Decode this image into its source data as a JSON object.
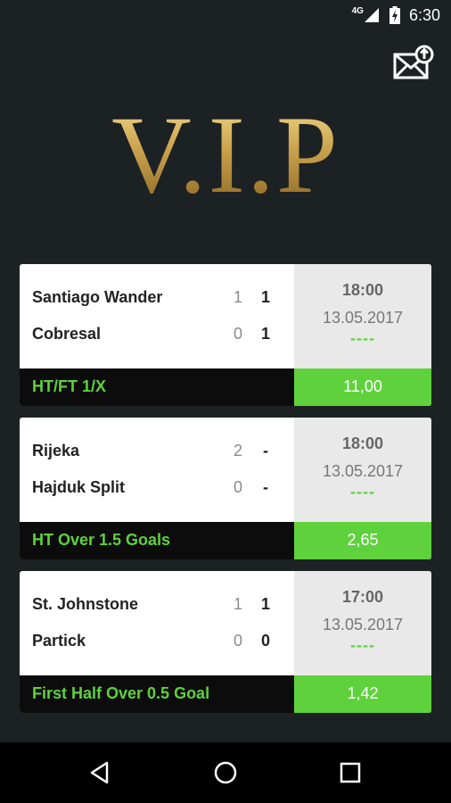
{
  "status_bar": {
    "network": "4G",
    "time": "6:30"
  },
  "header": {
    "logo_text": "V.I.P",
    "mail_icon": "mail-upload-icon"
  },
  "matches": [
    {
      "home_team": "Santiago Wander",
      "away_team": "Cobresal",
      "home_ht": "1",
      "home_ft": "1",
      "away_ht": "0",
      "away_ft": "1",
      "time": "18:00",
      "date": "13.05.2017",
      "status": "----",
      "tip": "HT/FT 1/X",
      "odds": "11,00"
    },
    {
      "home_team": "Rijeka",
      "away_team": "Hajduk Split",
      "home_ht": "2",
      "home_ft": "-",
      "away_ht": "0",
      "away_ft": "-",
      "time": "18:00",
      "date": "13.05.2017",
      "status": "----",
      "tip": "HT Over 1.5 Goals",
      "odds": "2,65"
    },
    {
      "home_team": "St. Johnstone",
      "away_team": "Partick",
      "home_ht": "1",
      "home_ft": "1",
      "away_ht": "0",
      "away_ft": "0",
      "time": "17:00",
      "date": "13.05.2017",
      "status": "----",
      "tip": "First Half Over 0.5 Goal",
      "odds": "1,42"
    }
  ],
  "colors": {
    "background": "#1c2124",
    "accent_green": "#5fd13c",
    "gold": "#c9a04b",
    "info_panel": "#e9e9e9"
  },
  "nav": {
    "back_icon": "back-triangle-icon",
    "home_icon": "home-circle-icon",
    "recents_icon": "recents-square-icon"
  }
}
